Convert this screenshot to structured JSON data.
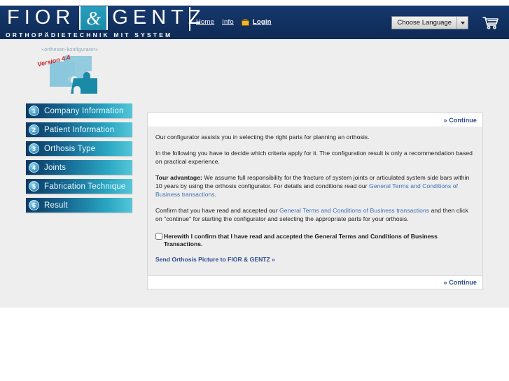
{
  "header": {
    "logo": {
      "part1": "FIOR",
      "amp": "&",
      "part2": "GENTZ",
      "tagline": "ORTHOPÄDIETECHNIK MIT SYSTEM"
    },
    "nav": [
      {
        "label": "Home",
        "name": "nav-home"
      },
      {
        "label": "Info",
        "name": "nav-info"
      },
      {
        "label": "Login",
        "name": "nav-login"
      }
    ],
    "language_select": {
      "value": "Choose Language"
    },
    "cart_icon": "shopping-cart-icon",
    "colors": {
      "header_bg": "#123366",
      "accent_teal": "#2196b4",
      "link_blue": "#3a6fb5"
    }
  },
  "sidebar": {
    "logo": {
      "caption": "»orthesen-konfigurator«",
      "version": "Version 4.4"
    },
    "steps": [
      {
        "num": "1",
        "label": "Company Information"
      },
      {
        "num": "2",
        "label": "Patient Information"
      },
      {
        "num": "3",
        "label": "Orthosis Type"
      },
      {
        "num": "4",
        "label": "Joints"
      },
      {
        "num": "5",
        "label": "Fabrication Technique"
      },
      {
        "num": "6",
        "label": "Result"
      }
    ]
  },
  "content": {
    "continue_top": "» Continue",
    "continue_bottom": "» Continue",
    "paragraph1": "Our configurator assists you in selecting the right parts for planning an orthosis.",
    "paragraph2": "In the following you have to decide which criteria apply for it. The configuration result is only a recommendation based on practical experience.",
    "paragraph3_lead": "Tour advantage:",
    "paragraph3_a": " We assume full responsibility for the fracture of system joints or articulated system side bars within 10 years by using the orthosis configurator. For details and conditions read our ",
    "paragraph3_link": "General Terms and Conditions of Business transactions",
    "paragraph3_b": ".",
    "paragraph4_a": "Confirm that you have read and accepted our ",
    "paragraph4_link": "General Terms and Conditions of Business transactions",
    "paragraph4_b": " and then click on \"continue\" for starting the configurator and selecting the appropriate parts for your orthosis.",
    "confirm_label": "Herewith I confirm that I have read and accepted the General Terms and Conditions of Business Transactions.",
    "confirm_checked": false,
    "send_picture_link": "Send Orthosis Picture to FIOR & GENTZ »"
  }
}
